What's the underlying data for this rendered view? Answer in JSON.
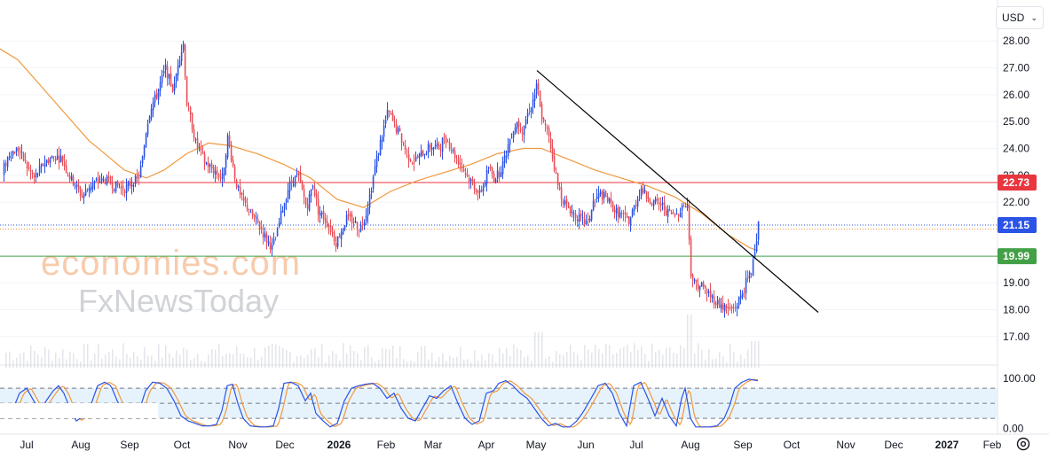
{
  "toolbar": {
    "currency_label": "USD"
  },
  "icons": {
    "currency_chevron": "chevron-down-icon",
    "settings": "gear-icon"
  },
  "watermark": {
    "line1": "economies.com",
    "line2": "FxNewsToday"
  },
  "colors": {
    "up": "#2b53e6",
    "down": "#e84f58",
    "ma": "#f0993e",
    "resistance": "#e8363f",
    "support": "#43a047",
    "trendline": "#000000",
    "price_tag": "#2b53e6",
    "stoch_k": "#2b53e6",
    "stoch_d": "#f0993e",
    "stoch_band": "#dbeefc"
  },
  "chart_data": [
    {
      "type": "candlestick",
      "title": "",
      "ylim": [
        16.4,
        28.6
      ],
      "y_ticks": [
        17.0,
        18.0,
        19.0,
        22.0,
        23.0,
        24.0,
        25.0,
        26.0,
        27.0,
        28.0
      ],
      "y_tick_labels": [
        "17.00",
        "18.00",
        "19.00",
        "22.00",
        "23.00",
        "24.00",
        "25.00",
        "26.00",
        "27.00",
        "28.00"
      ],
      "x_tick_labels": [
        "Jul",
        "Aug",
        "Sep",
        "Oct",
        "Nov",
        "Dec",
        "2026",
        "Feb",
        "Mar",
        "Apr",
        "May",
        "Jun",
        "Jul",
        "Aug",
        "Sep",
        "Oct",
        "Nov",
        "Dec",
        "2027",
        "Feb"
      ],
      "x_tick_bold": [
        false,
        false,
        false,
        false,
        false,
        false,
        true,
        false,
        false,
        false,
        false,
        false,
        false,
        false,
        false,
        false,
        false,
        false,
        true,
        false
      ],
      "close_path": [
        [
          0,
          23.0
        ],
        [
          10,
          23.8
        ],
        [
          20,
          24.0
        ],
        [
          30,
          23.3
        ],
        [
          38,
          22.9
        ],
        [
          50,
          23.5
        ],
        [
          60,
          23.7
        ],
        [
          70,
          23.6
        ],
        [
          75,
          23.1
        ],
        [
          85,
          22.6
        ],
        [
          92,
          22.2
        ],
        [
          100,
          22.6
        ],
        [
          110,
          22.8
        ],
        [
          120,
          22.8
        ],
        [
          130,
          22.6
        ],
        [
          140,
          22.5
        ],
        [
          150,
          22.8
        ],
        [
          155,
          22.8
        ],
        [
          160,
          23.6
        ],
        [
          165,
          24.9
        ],
        [
          170,
          25.6
        ],
        [
          175,
          25.9
        ],
        [
          180,
          26.4
        ],
        [
          186,
          27.0
        ],
        [
          190,
          26.6
        ],
        [
          195,
          26.1
        ],
        [
          200,
          27.2
        ],
        [
          206,
          27.9
        ],
        [
          210,
          25.7
        ],
        [
          215,
          25.0
        ],
        [
          220,
          24.2
        ],
        [
          230,
          23.5
        ],
        [
          240,
          23.2
        ],
        [
          250,
          22.9
        ],
        [
          256,
          24.4
        ],
        [
          260,
          23.7
        ],
        [
          265,
          22.8
        ],
        [
          270,
          22.2
        ],
        [
          280,
          21.7
        ],
        [
          290,
          21.2
        ],
        [
          300,
          20.6
        ],
        [
          306,
          20.3
        ],
        [
          312,
          20.9
        ],
        [
          318,
          21.8
        ],
        [
          325,
          22.6
        ],
        [
          332,
          22.9
        ],
        [
          335,
          23.0
        ],
        [
          340,
          22.4
        ],
        [
          345,
          21.8
        ],
        [
          352,
          22.7
        ],
        [
          358,
          21.7
        ],
        [
          365,
          21.4
        ],
        [
          372,
          21.0
        ],
        [
          378,
          20.5
        ],
        [
          385,
          21.0
        ],
        [
          390,
          21.4
        ],
        [
          398,
          21.3
        ],
        [
          405,
          21.0
        ],
        [
          412,
          21.6
        ],
        [
          418,
          22.6
        ],
        [
          425,
          23.8
        ],
        [
          432,
          24.8
        ],
        [
          437,
          25.4
        ],
        [
          443,
          24.9
        ],
        [
          450,
          24.5
        ],
        [
          458,
          23.8
        ],
        [
          465,
          23.5
        ],
        [
          475,
          23.8
        ],
        [
          485,
          24.1
        ],
        [
          495,
          24.0
        ],
        [
          500,
          24.5
        ],
        [
          508,
          24.0
        ],
        [
          515,
          23.6
        ],
        [
          520,
          23.3
        ],
        [
          525,
          23.0
        ],
        [
          532,
          22.7
        ],
        [
          540,
          22.3
        ],
        [
          545,
          22.7
        ],
        [
          550,
          23.3
        ],
        [
          556,
          22.9
        ],
        [
          562,
          23.1
        ],
        [
          568,
          23.6
        ],
        [
          575,
          24.5
        ],
        [
          582,
          25.0
        ],
        [
          588,
          24.7
        ],
        [
          594,
          25.3
        ],
        [
          600,
          25.8
        ],
        [
          605,
          26.4
        ],
        [
          608,
          25.5
        ],
        [
          612,
          24.9
        ],
        [
          618,
          24.5
        ],
        [
          623,
          23.5
        ],
        [
          628,
          22.6
        ],
        [
          635,
          22.0
        ],
        [
          645,
          21.6
        ],
        [
          655,
          21.3
        ],
        [
          662,
          21.2
        ],
        [
          668,
          22.0
        ],
        [
          676,
          22.3
        ],
        [
          684,
          22.1
        ],
        [
          692,
          21.7
        ],
        [
          700,
          21.5
        ],
        [
          708,
          21.3
        ],
        [
          715,
          21.9
        ],
        [
          722,
          22.5
        ],
        [
          728,
          22.2
        ],
        [
          735,
          22.0
        ],
        [
          745,
          21.9
        ],
        [
          752,
          21.6
        ],
        [
          760,
          21.5
        ],
        [
          765,
          21.7
        ],
        [
          770,
          21.9
        ],
        [
          775,
          21.8
        ],
        [
          777,
          19.5
        ],
        [
          782,
          19.0
        ],
        [
          790,
          18.9
        ],
        [
          798,
          18.6
        ],
        [
          806,
          18.3
        ],
        [
          814,
          18.1
        ],
        [
          822,
          18.0
        ],
        [
          828,
          18.1
        ],
        [
          834,
          18.5
        ],
        [
          840,
          19.0
        ],
        [
          846,
          19.4
        ],
        [
          850,
          20.3
        ],
        [
          854,
          21.15
        ]
      ],
      "moving_average": [
        [
          0,
          27.7
        ],
        [
          20,
          27.3
        ],
        [
          60,
          25.8
        ],
        [
          100,
          24.3
        ],
        [
          140,
          23.2
        ],
        [
          165,
          22.9
        ],
        [
          185,
          23.2
        ],
        [
          210,
          23.8
        ],
        [
          235,
          24.2
        ],
        [
          260,
          24.1
        ],
        [
          290,
          23.8
        ],
        [
          320,
          23.4
        ],
        [
          350,
          22.9
        ],
        [
          380,
          22.1
        ],
        [
          410,
          21.8
        ],
        [
          440,
          22.4
        ],
        [
          470,
          22.8
        ],
        [
          500,
          23.1
        ],
        [
          530,
          23.4
        ],
        [
          560,
          23.8
        ],
        [
          590,
          24.0
        ],
        [
          610,
          24.0
        ],
        [
          640,
          23.6
        ],
        [
          670,
          23.2
        ],
        [
          700,
          22.9
        ],
        [
          730,
          22.6
        ],
        [
          760,
          22.2
        ],
        [
          790,
          21.6
        ],
        [
          820,
          20.8
        ],
        [
          845,
          20.3
        ],
        [
          854,
          20.2
        ]
      ],
      "horizontal_lines": [
        {
          "value": 22.73,
          "label": "22.73",
          "style": "solid",
          "color": "#e8363f"
        },
        {
          "value": 19.99,
          "label": "19.99",
          "style": "solid",
          "color": "#43a047"
        },
        {
          "value": 21.15,
          "label": "21.15",
          "style": "dotted",
          "color": "#2b53e6"
        },
        {
          "value": 21.0,
          "label": "",
          "style": "dotted",
          "color": "#f0993e"
        }
      ],
      "trendline": {
        "start": [
          605,
          26.9
        ],
        "end": [
          922,
          17.9
        ]
      },
      "volume_bars": true
    },
    {
      "type": "line",
      "title": "",
      "ylim": [
        -8,
        112
      ],
      "y_tick_labels": [
        "100.00",
        "0.00"
      ],
      "y_ticks": [
        100,
        0
      ],
      "band": [
        20,
        80
      ],
      "series": [
        {
          "values_k": [
            [
              0,
              45
            ],
            [
              8,
              25
            ],
            [
              15,
              40
            ],
            [
              22,
              70
            ],
            [
              30,
              80
            ],
            [
              38,
              55
            ],
            [
              45,
              30
            ],
            [
              52,
              55
            ],
            [
              60,
              75
            ],
            [
              66,
              85
            ],
            [
              72,
              70
            ],
            [
              80,
              35
            ],
            [
              86,
              15
            ],
            [
              95,
              25
            ],
            [
              102,
              45
            ],
            [
              110,
              85
            ],
            [
              118,
              92
            ],
            [
              125,
              85
            ],
            [
              132,
              55
            ],
            [
              140,
              30
            ],
            [
              148,
              50
            ],
            [
              156,
              30
            ],
            [
              164,
              75
            ],
            [
              172,
              92
            ],
            [
              180,
              90
            ],
            [
              188,
              80
            ],
            [
              196,
              55
            ],
            [
              204,
              25
            ],
            [
              212,
              15
            ],
            [
              220,
              10
            ],
            [
              228,
              5
            ],
            [
              236,
              5
            ],
            [
              244,
              8
            ],
            [
              250,
              35
            ],
            [
              256,
              85
            ],
            [
              262,
              88
            ],
            [
              268,
              50
            ],
            [
              274,
              20
            ],
            [
              282,
              5
            ],
            [
              292,
              3
            ],
            [
              300,
              3
            ],
            [
              308,
              5
            ],
            [
              314,
              40
            ],
            [
              320,
              90
            ],
            [
              328,
              92
            ],
            [
              336,
              85
            ],
            [
              344,
              55
            ],
            [
              350,
              70
            ],
            [
              356,
              30
            ],
            [
              364,
              15
            ],
            [
              372,
              3
            ],
            [
              380,
              10
            ],
            [
              388,
              55
            ],
            [
              396,
              80
            ],
            [
              404,
              85
            ],
            [
              412,
              88
            ],
            [
              420,
              90
            ],
            [
              428,
              80
            ],
            [
              436,
              60
            ],
            [
              444,
              70
            ],
            [
              452,
              40
            ],
            [
              460,
              20
            ],
            [
              468,
              15
            ],
            [
              476,
              40
            ],
            [
              484,
              65
            ],
            [
              492,
              60
            ],
            [
              500,
              75
            ],
            [
              508,
              85
            ],
            [
              516,
              50
            ],
            [
              524,
              20
            ],
            [
              532,
              8
            ],
            [
              540,
              15
            ],
            [
              548,
              70
            ],
            [
              556,
              75
            ],
            [
              562,
              90
            ],
            [
              570,
              95
            ],
            [
              578,
              85
            ],
            [
              586,
              70
            ],
            [
              594,
              60
            ],
            [
              602,
              40
            ],
            [
              610,
              20
            ],
            [
              618,
              5
            ],
            [
              626,
              10
            ],
            [
              634,
              3
            ],
            [
              642,
              3
            ],
            [
              650,
              15
            ],
            [
              658,
              35
            ],
            [
              666,
              60
            ],
            [
              674,
              85
            ],
            [
              682,
              90
            ],
            [
              690,
              70
            ],
            [
              698,
              30
            ],
            [
              706,
              5
            ],
            [
              714,
              85
            ],
            [
              722,
              92
            ],
            [
              730,
              60
            ],
            [
              738,
              25
            ],
            [
              746,
              60
            ],
            [
              754,
              25
            ],
            [
              762,
              5
            ],
            [
              768,
              60
            ],
            [
              772,
              80
            ],
            [
              778,
              20
            ],
            [
              784,
              3
            ],
            [
              792,
              3
            ],
            [
              800,
              3
            ],
            [
              808,
              5
            ],
            [
              816,
              20
            ],
            [
              822,
              45
            ],
            [
              828,
              80
            ],
            [
              836,
              92
            ],
            [
              844,
              98
            ],
            [
              854,
              95
            ]
          ]
        }
      ]
    }
  ]
}
